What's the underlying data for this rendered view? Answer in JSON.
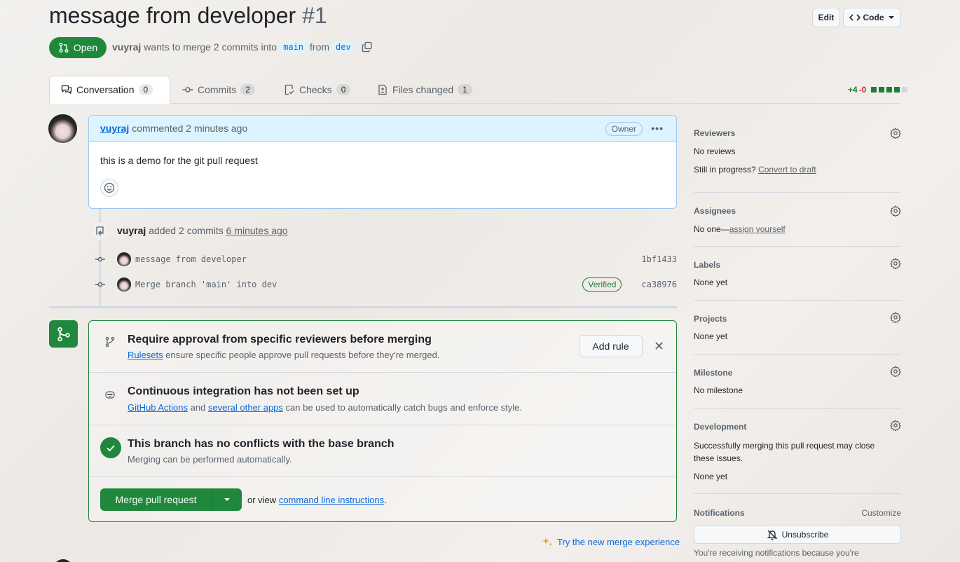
{
  "header": {
    "title": "message from developer",
    "number": "#1",
    "edit_label": "Edit",
    "code_label": "Code",
    "state": "Open",
    "author": "vuyraj",
    "merge_text": "wants to merge 2 commits into",
    "base_branch": "main",
    "from_text": "from",
    "head_branch": "dev"
  },
  "tabs": [
    {
      "label": "Conversation",
      "count": "0"
    },
    {
      "label": "Commits",
      "count": "2"
    },
    {
      "label": "Checks",
      "count": "0"
    },
    {
      "label": "Files changed",
      "count": "1"
    }
  ],
  "diffstat": {
    "additions": "+4",
    "deletions": "-0"
  },
  "comment": {
    "author": "vuyraj",
    "action": "commented 2 minutes ago",
    "role": "Owner",
    "body": "this is a demo for the git pull request"
  },
  "push_event": {
    "author": "vuyraj",
    "action": "added 2 commits",
    "when": "6 minutes ago"
  },
  "commits": [
    {
      "message": "message from developer",
      "sha": "1bf1433",
      "verified": ""
    },
    {
      "message": "Merge branch 'main' into dev",
      "sha": "ca38976",
      "verified": "Verified"
    }
  ],
  "merge_box": {
    "rules_title": "Require approval from specific reviewers before merging",
    "rules_link": "Rulesets",
    "rules_sub": "ensure specific people approve pull requests before they're merged.",
    "add_rule_label": "Add rule",
    "ci_title": "Continuous integration has not been set up",
    "ci_link1": "GitHub Actions",
    "ci_and": "and",
    "ci_link2": "several other apps",
    "ci_sub": "can be used to automatically catch bugs and enforce style.",
    "conflict_title": "This branch has no conflicts with the base branch",
    "conflict_sub": "Merging can be performed automatically.",
    "merge_label": "Merge pull request",
    "or_view": "or view",
    "cli_link": "command line instructions",
    "period": ".",
    "try_new": "Try the new merge experience"
  },
  "sidebar": {
    "reviewers": {
      "heading": "Reviewers",
      "value": "No reviews",
      "progress_text": "Still in progress?",
      "draft_link": "Convert to draft"
    },
    "assignees": {
      "heading": "Assignees",
      "value": "No one—",
      "assign_link": "assign yourself"
    },
    "labels": {
      "heading": "Labels",
      "value": "None yet"
    },
    "projects": {
      "heading": "Projects",
      "value": "None yet"
    },
    "milestone": {
      "heading": "Milestone",
      "value": "No milestone"
    },
    "development": {
      "heading": "Development",
      "desc": "Successfully merging this pull request may close these issues.",
      "value": "None yet"
    },
    "notifications": {
      "heading": "Notifications",
      "customize": "Customize",
      "unsubscribe": "Unsubscribe",
      "reason": "You're receiving notifications because you're"
    }
  },
  "colors": {
    "accent": "#0969da",
    "success": "#1f883d",
    "danger": "#cf222e",
    "comment_header_bg": "#ddf4ff"
  }
}
